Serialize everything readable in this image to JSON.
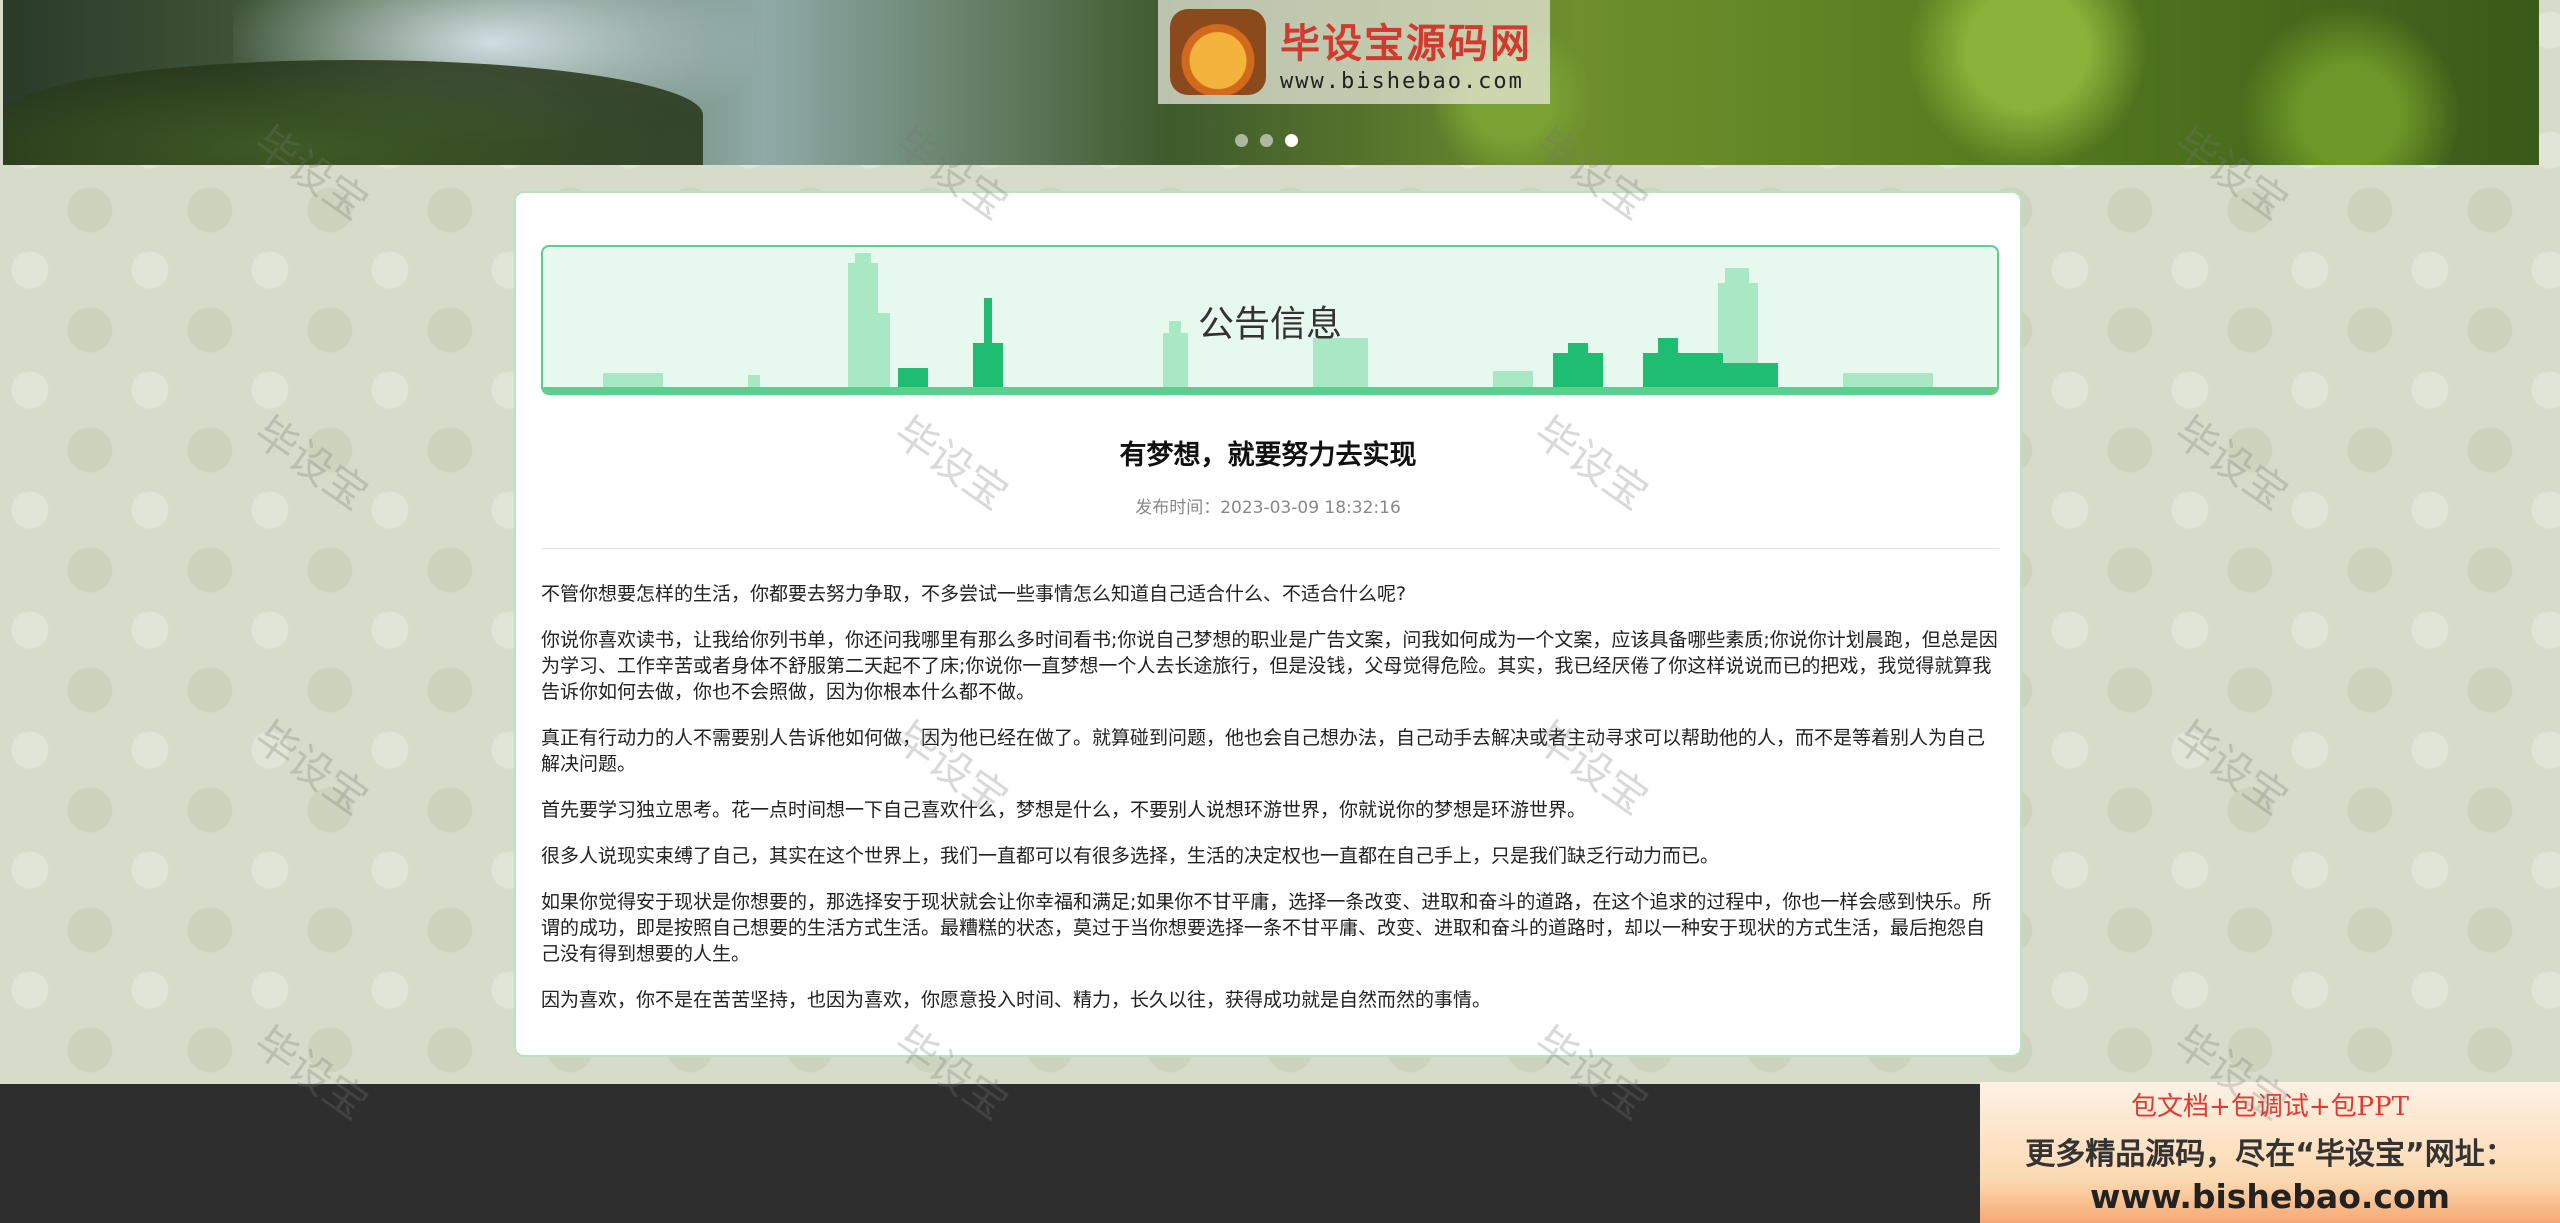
{
  "banner": {
    "logo_title": "毕设宝源码网",
    "logo_url": "www.bishebao.com",
    "slides": 3,
    "active_slide": 3
  },
  "notice": {
    "heading": "公告信息"
  },
  "article": {
    "title": "有梦想，就要努力去实现",
    "meta": "发布时间：2023-03-09 18:32:16",
    "paragraphs": [
      "不管你想要怎样的生活，你都要去努力争取，不多尝试一些事情怎么知道自己适合什么、不适合什么呢?",
      "你说你喜欢读书，让我给你列书单，你还问我哪里有那么多时间看书;你说自己梦想的职业是广告文案，问我如何成为一个文案，应该具备哪些素质;你说你计划晨跑，但总是因为学习、工作辛苦或者身体不舒服第二天起不了床;你说你一直梦想一个人去长途旅行，但是没钱，父母觉得危险。其实，我已经厌倦了你这样说说而已的把戏，我觉得就算我告诉你如何去做，你也不会照做，因为你根本什么都不做。",
      "真正有行动力的人不需要别人告诉他如何做，因为他已经在做了。就算碰到问题，他也会自己想办法，自己动手去解决或者主动寻求可以帮助他的人，而不是等着别人为自己解决问题。",
      "首先要学习独立思考。花一点时间想一下自己喜欢什么，梦想是什么，不要别人说想环游世界，你就说你的梦想是环游世界。",
      "很多人说现实束缚了自己，其实在这个世界上，我们一直都可以有很多选择，生活的决定权也一直都在自己手上，只是我们缺乏行动力而已。",
      "如果你觉得安于现状是你想要的，那选择安于现状就会让你幸福和满足;如果你不甘平庸，选择一条改变、进取和奋斗的道路，在这个追求的过程中，你也一样会感到快乐。所谓的成功，即是按照自己想要的生活方式生活。最糟糕的状态，莫过于当你想要选择一条不甘平庸、改变、进取和奋斗的道路时，却以一种安于现状的方式生活，最后抱怨自己没有得到想要的人生。",
      "因为喜欢，你不是在苦苦坚持，也因为喜欢，你愿意投入时间、精力，长久以往，获得成功就是自然而然的事情。"
    ]
  },
  "ad": {
    "line1": "包文档+包调试+包PPT",
    "line2": "更多精品源码，尽在“毕设宝”网址：",
    "line3": "www.bishebao.com"
  },
  "watermark": "毕设宝",
  "colors": {
    "accent_green": "#5ccf8f",
    "card_border": "#b7e3c5",
    "footer": "#2e2e2e"
  }
}
